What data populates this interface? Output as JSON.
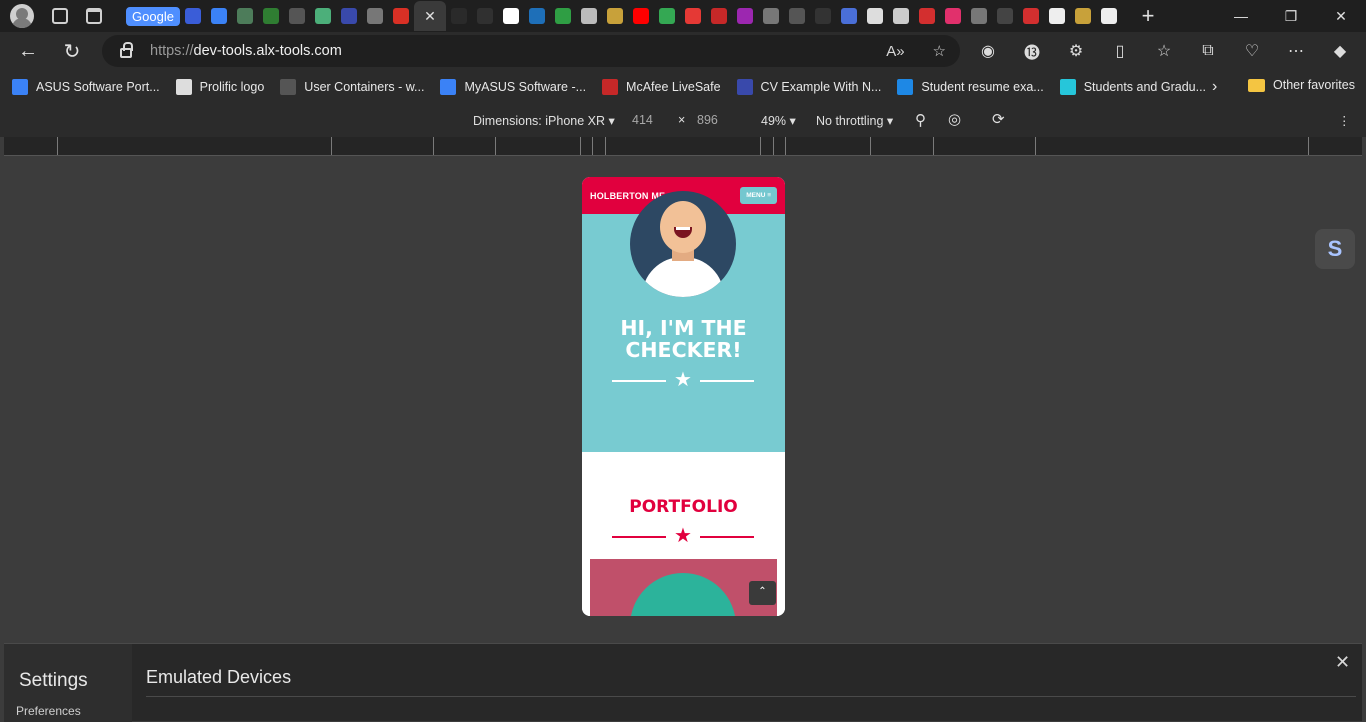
{
  "tabstrip": {
    "google_tab_label": "Google",
    "close_tab": "✕",
    "new_tab": "+",
    "minimize": "—",
    "restore": "❐",
    "close_window": "✕",
    "favicons": [
      "#3a5dd8",
      "#3b82f6",
      "#4d7c5a",
      "#2f7d32",
      "#555555",
      "#4caf7a",
      "#3949ab",
      "#777777",
      "#d93025",
      "#2a2a2a",
      "#303030",
      "#ffffff",
      "#1e6fb8",
      "#2f9e44",
      "#bbbbbb",
      "#c8a13a",
      "#ff0000",
      "#34a853",
      "#e53935",
      "#c62828",
      "#9c27b0",
      "#777777",
      "#555555",
      "#333333",
      "#4a6fd8",
      "#dddddd",
      "#cccccc",
      "#d32f2f",
      "#e1306c",
      "#777777",
      "#444444",
      "#d32f2f",
      "#eeeeee",
      "#c8a13a",
      "#eeeeee"
    ]
  },
  "navbar": {
    "back": "←",
    "reload": "↻",
    "url_scheme": "https://",
    "url_host": "dev-tools.alx-tools.com",
    "read_aloud": "A»",
    "favorite": "☆",
    "extensions": [
      "◉",
      "⓭",
      "⚙",
      "▯",
      "☆",
      "⧉",
      "♡",
      "⋯",
      "◆"
    ]
  },
  "bookmarks": {
    "items": [
      {
        "label": "ASUS Software Port...",
        "color": "#3b82f6"
      },
      {
        "label": "Prolific logo",
        "color": "#dddddd"
      },
      {
        "label": "User Containers - w...",
        "color": "#555555"
      },
      {
        "label": "MyASUS Software -...",
        "color": "#3b82f6"
      },
      {
        "label": "McAfee LiveSafe",
        "color": "#c62828"
      },
      {
        "label": "CV Example With N...",
        "color": "#3949ab"
      },
      {
        "label": "Student resume exa...",
        "color": "#1e88e5"
      },
      {
        "label": "Students and Gradu...",
        "color": "#26c6da"
      }
    ],
    "more": "›",
    "other_favorites": "Other favorites"
  },
  "devtools_toolbar": {
    "dimensions_label": "Dimensions: iPhone XR",
    "width": "414",
    "times": "×",
    "height": "896",
    "zoom": "49%",
    "throttling": "No throttling",
    "more": "⋮"
  },
  "site": {
    "brand": "HOLBERTON ME",
    "menu_label": "MENU ≡",
    "hero_title_line1": "HI, I'M THE",
    "hero_title_line2": "CHECKER!",
    "star": "★",
    "portfolio_title": "PORTFOLIO",
    "to_top": "⌃",
    "colors": {
      "primary": "#e1003e",
      "teal": "#78cbd1",
      "card": "#c0506a"
    }
  },
  "side_badge": "S",
  "settings": {
    "title": "Settings",
    "sub": "Preferences",
    "section_title": "Emulated Devices",
    "close": "✕"
  }
}
